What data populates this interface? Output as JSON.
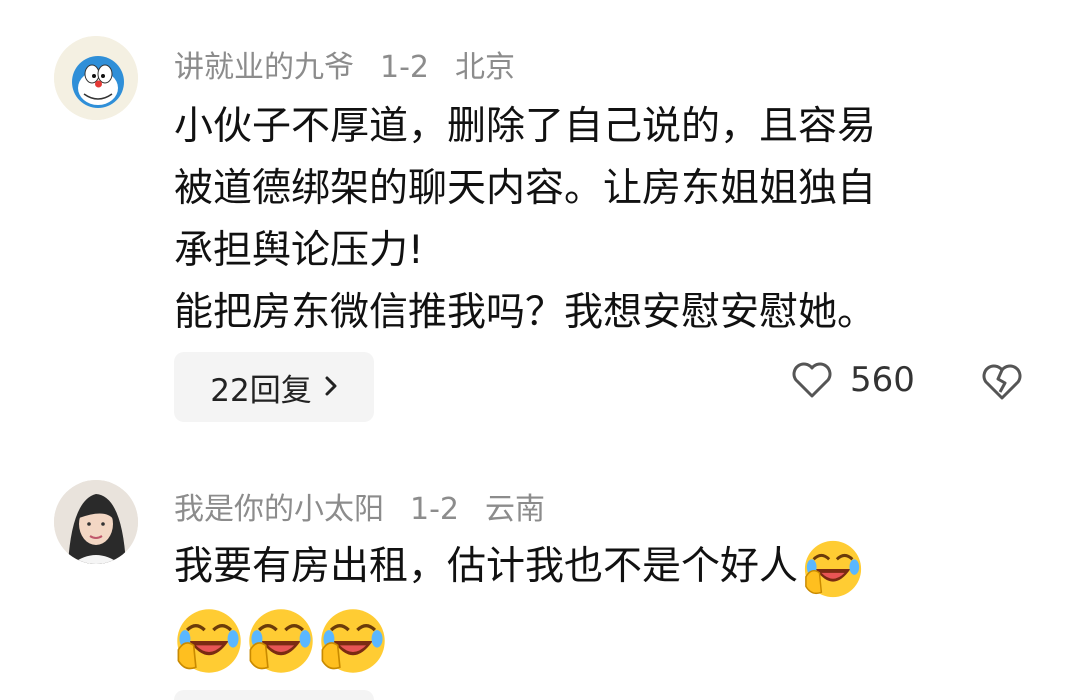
{
  "comments": [
    {
      "username": "讲就业的九爷",
      "date": "1-2",
      "location": "北京",
      "lines": [
        "小伙子不厚道，删除了自己说的，且容易",
        "被道德绑架的聊天内容。让房东姐姐独自",
        "承担舆论压力!",
        "能把房东微信推我吗？我想安慰安慰她。"
      ],
      "reply_button": "22回复",
      "likes": "560",
      "avatar_icon": "doraemon-avatar",
      "icons": {
        "like": "heart-icon",
        "dislike": "broken-heart-icon",
        "chevron": "chevron-right-icon"
      }
    },
    {
      "username": "我是你的小太阳",
      "date": "1-2",
      "location": "云南",
      "line1": "我要有房出租，估计我也不是个好人",
      "emoji_name": "laugh-cry-emoji",
      "emoji_row_count": 3,
      "avatar_icon": "person-photo-avatar"
    }
  ],
  "colors": {
    "meta": "#8c8c8c",
    "text": "#111111",
    "reply_bg": "#f4f4f4",
    "icon": "#555555"
  }
}
